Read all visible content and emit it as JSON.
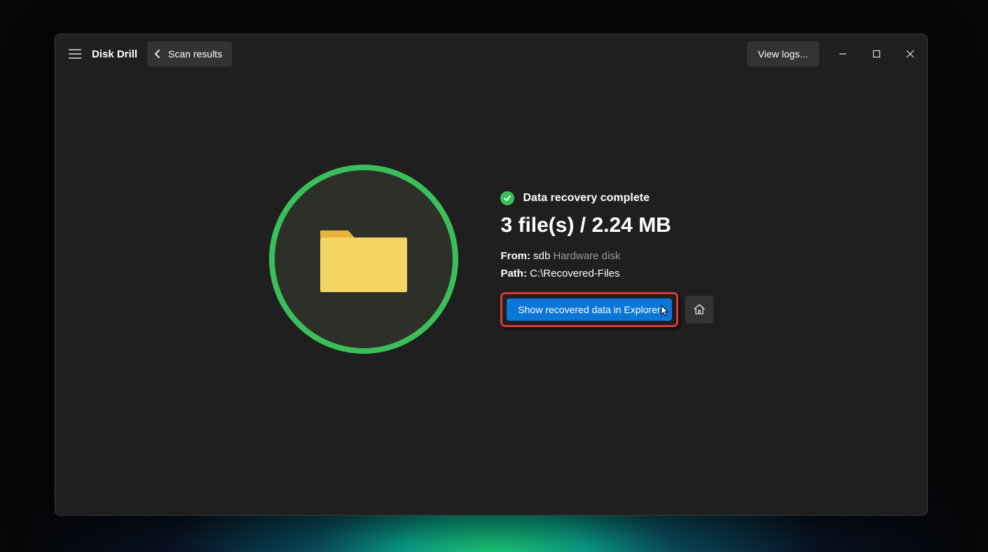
{
  "header": {
    "app_title": "Disk Drill",
    "back_label": "Scan results",
    "view_logs_label": "View logs..."
  },
  "result": {
    "status_text": "Data recovery complete",
    "summary": "3 file(s) / 2.24 MB",
    "from_label": "From:",
    "from_value": "sdb",
    "from_type": "Hardware disk",
    "path_label": "Path:",
    "path_value": "C:\\Recovered-Files",
    "show_button_label": "Show recovered data in Explorer"
  }
}
